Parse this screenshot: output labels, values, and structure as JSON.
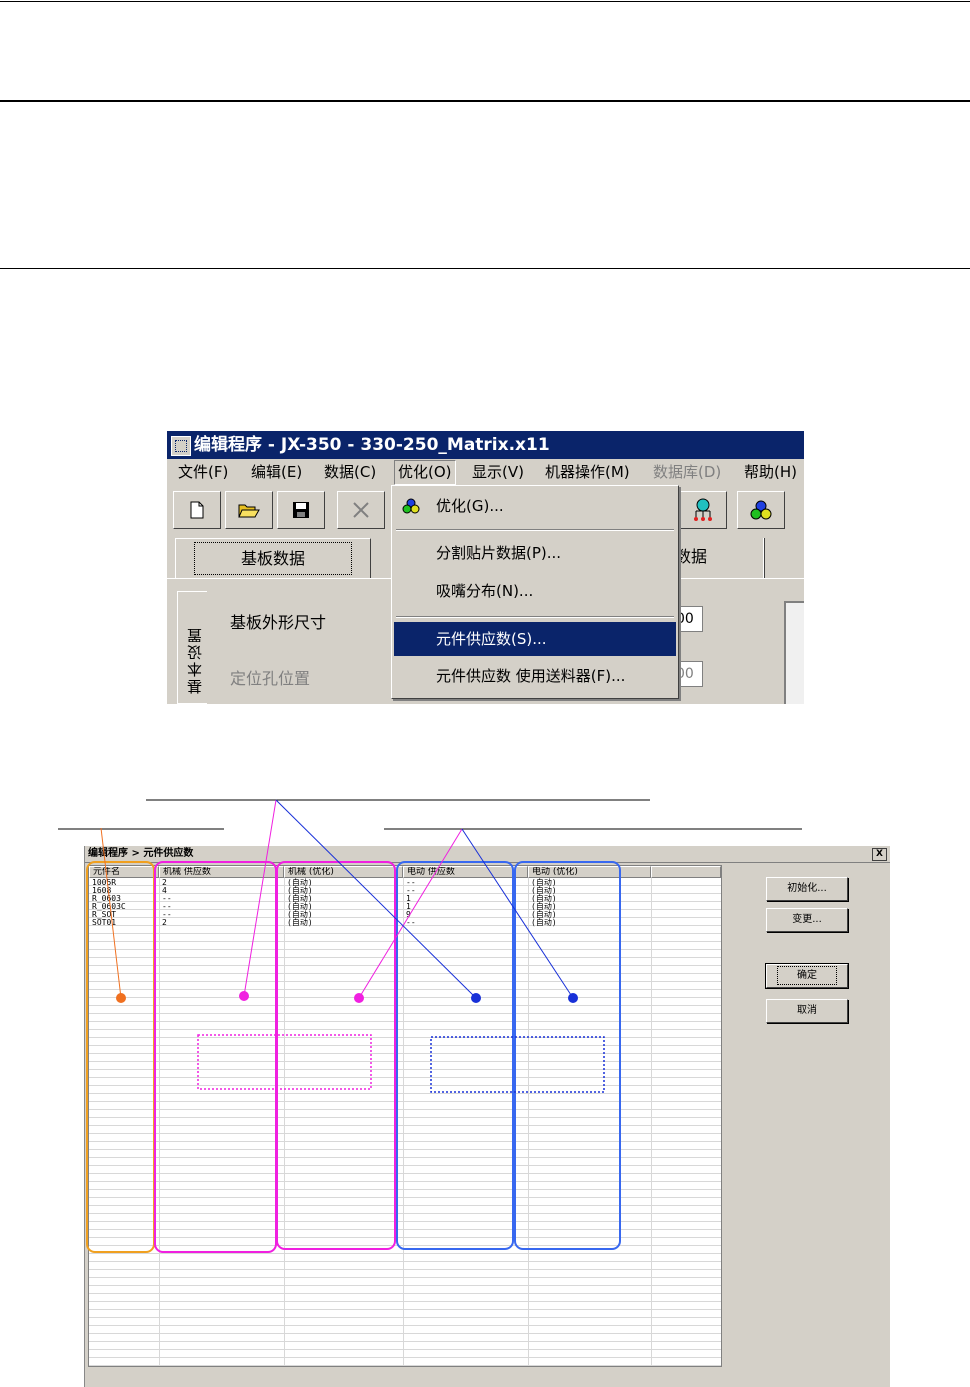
{
  "menu_screenshot": {
    "title": "编辑程序 - JX-350 - 330-250_Matrix.x11",
    "menubar": [
      {
        "label": "文件(F)"
      },
      {
        "label": "编辑(E)"
      },
      {
        "label": "数据(C)"
      },
      {
        "label": "优化(O)"
      },
      {
        "label": "显示(V)"
      },
      {
        "label": "机器操作(M)"
      },
      {
        "label": "数据库(D)"
      },
      {
        "label": "帮助(H)"
      }
    ],
    "toolbar_icons": [
      "new-file-icon",
      "open-folder-icon",
      "save-icon",
      "delete-icon",
      "nozzle-icon",
      "optimize-icon"
    ],
    "tabs": {
      "board_data": "基板数据",
      "partial": "数据"
    },
    "side_tab": "基本设置",
    "fields": [
      {
        "label": "基板外形尺寸",
        "value": "00"
      },
      {
        "label": "定位孔位置",
        "value": "00"
      }
    ],
    "optimize_menu": {
      "items": [
        {
          "label": "优化(G)..."
        },
        {
          "label": "分割贴片数据(P)..."
        },
        {
          "label": "吸嘴分布(N)..."
        },
        {
          "label": "元件供应数(S)..."
        },
        {
          "label": "元件供应数 使用送料器(F)..."
        }
      ]
    }
  },
  "dialog_screenshot": {
    "title": "编辑程序 > 元件供应数",
    "close_label": "X",
    "columns": [
      "元件名",
      "机械 供应数",
      "机械 (优化)",
      "电动 供应数",
      "电动 (优化)",
      ""
    ],
    "rows": [
      [
        "1005R",
        "2",
        "(自动)",
        "--",
        "(自动)"
      ],
      [
        "1608",
        "4",
        "(自动)",
        "--",
        "(自动)"
      ],
      [
        "R_0603",
        "--",
        "(自动)",
        "1",
        "(自动)"
      ],
      [
        "R_0603C",
        "--",
        "(自动)",
        "1",
        "(自动)"
      ],
      [
        "R_SOT",
        "--",
        "(自动)",
        "9",
        "(自动)"
      ],
      [
        "SOT01",
        "2",
        "(自动)",
        "--",
        "(自动)"
      ]
    ],
    "buttons": {
      "init": "初始化...",
      "change": "变更...",
      "ok": "确定",
      "cancel": "取消"
    }
  },
  "annotation_colors": {
    "orange": "#f07020",
    "magenta": "#f020e0",
    "blue": "#1830d8",
    "orange_frame": "#f0a020",
    "blue_frame": "#3868f0"
  }
}
